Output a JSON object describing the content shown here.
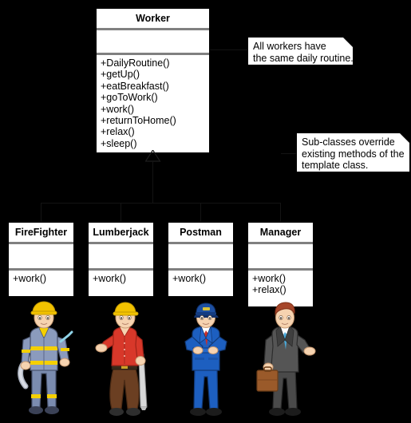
{
  "diagram": {
    "title": "Worker template method UML class diagram",
    "background_color": "#000000",
    "box_fill": "#ffffff",
    "separator_color": "#808080"
  },
  "base_class": {
    "name": "Worker",
    "attributes": [],
    "operations": [
      "+DailyRoutine()",
      "+getUp()",
      "+eatBreakfast()",
      "+goToWork()",
      "+work()",
      "+returnToHome()",
      "+relax()",
      "+sleep()"
    ]
  },
  "notes": [
    {
      "id": "note-daily-routine",
      "lines": [
        "All workers have",
        "the same daily routine."
      ]
    },
    {
      "id": "note-override",
      "lines": [
        "Sub-classes override",
        "existing methods of the",
        "template class."
      ]
    }
  ],
  "subclasses": [
    {
      "name": "FireFighter",
      "attributes": [],
      "operations": [
        "+work()"
      ],
      "figure": "firefighter"
    },
    {
      "name": "Lumberjack",
      "attributes": [],
      "operations": [
        "+work()"
      ],
      "figure": "lumberjack"
    },
    {
      "name": "Postman",
      "attributes": [],
      "operations": [
        "+work()"
      ],
      "figure": "postman"
    },
    {
      "name": "Manager",
      "attributes": [],
      "operations": [
        "+work()",
        "+relax()"
      ],
      "figure": "manager"
    }
  ],
  "figures": {
    "firefighter": {
      "label": "firefighter-illustration",
      "colors": {
        "helmet": "#f2c200",
        "uniform": "#7b8cb0",
        "stripe": "#f5d000",
        "skin": "#f6d3b0",
        "hose": "#c9cdd6"
      }
    },
    "lumberjack": {
      "label": "lumberjack-illustration",
      "colors": {
        "hardhat": "#f2c200",
        "shirt": "#d8382a",
        "pants": "#6b3f22",
        "skin": "#f6d3b0",
        "saw": "#d8d8d8"
      }
    },
    "postman": {
      "label": "postman-illustration",
      "colors": {
        "cap": "#1d4fa0",
        "suit": "#1d5fc0",
        "tie": "#c8302a",
        "shirt": "#ffffff",
        "skin": "#f6d3b0"
      }
    },
    "manager": {
      "label": "manager-illustration",
      "colors": {
        "hair": "#a6462a",
        "suit": "#4a4a4a",
        "tie": "#4aa8d8",
        "briefcase": "#9a5a2a",
        "skin": "#f6d3b0"
      }
    }
  },
  "relationship": {
    "type": "generalization",
    "arrow": "hollow-triangle",
    "line_color": "#141414"
  }
}
